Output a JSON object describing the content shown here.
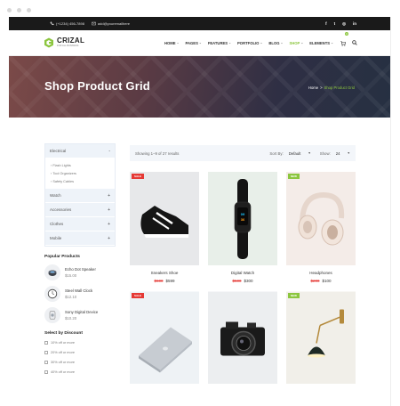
{
  "topbar": {
    "phone": "(+1234) 456-7898",
    "email": "add@youremailhere"
  },
  "logo": {
    "name": "CRIZAL",
    "tagline": "FOR ALL BUSINESS"
  },
  "nav": {
    "items": [
      {
        "label": "HOME",
        "active": false
      },
      {
        "label": "PAGES",
        "active": false
      },
      {
        "label": "FEATURES",
        "active": false
      },
      {
        "label": "PORTFOLIO",
        "active": false
      },
      {
        "label": "BLOG",
        "active": false
      },
      {
        "label": "SHOP",
        "active": true
      },
      {
        "label": "ELEMENTS",
        "active": false
      }
    ],
    "cart_count": "0"
  },
  "banner": {
    "title": "Shop Product Grid",
    "breadcrumb_home": "Home",
    "breadcrumb_sep": ">",
    "breadcrumb_current": "Shop Product Grid"
  },
  "sidebar": {
    "categories": [
      {
        "label": "Electrical",
        "sign": "-"
      },
      {
        "label": "Watch",
        "sign": "+"
      },
      {
        "label": "Accessories",
        "sign": "+"
      },
      {
        "label": "Clothes",
        "sign": "+"
      },
      {
        "label": "Mobile",
        "sign": "+"
      }
    ],
    "subcategories": [
      "Flash Lights",
      "Tool Organizers",
      "Safety Cables"
    ],
    "popular_title": "Popular Products",
    "popular": [
      {
        "name": "Echo Dot Speaker",
        "price": "$15.00"
      },
      {
        "name": "Steel Wall Clock",
        "price": "$12.10"
      },
      {
        "name": "Sony Digital Device",
        "price": "$10.20"
      }
    ],
    "discount_title": "Select by Discount",
    "discounts": [
      "10% off or more",
      "20% off or more",
      "30% off or more",
      "40% off or more"
    ]
  },
  "toolbar": {
    "results": "Showing 1–9 of 27 results",
    "sort_label": "Sort By:",
    "sort_value": "Default",
    "show_label": "Show:",
    "show_value": "24"
  },
  "products": [
    {
      "name": "Sneakers Shoe",
      "old_price": "$600",
      "price": "$599",
      "badge": "SALE"
    },
    {
      "name": "Digital Watch",
      "old_price": "$500",
      "price": "$300",
      "badge": ""
    },
    {
      "name": "Headphones",
      "old_price": "$200",
      "price": "$100",
      "badge": "NEW"
    },
    {
      "name": "",
      "old_price": "",
      "price": "",
      "badge": "SALE"
    },
    {
      "name": "",
      "old_price": "",
      "price": "",
      "badge": ""
    },
    {
      "name": "",
      "old_price": "",
      "price": "",
      "badge": "NEW"
    }
  ],
  "colors": {
    "accent": "#8cc63f",
    "sale": "#e53935",
    "topbar": "#1a1a1a"
  }
}
